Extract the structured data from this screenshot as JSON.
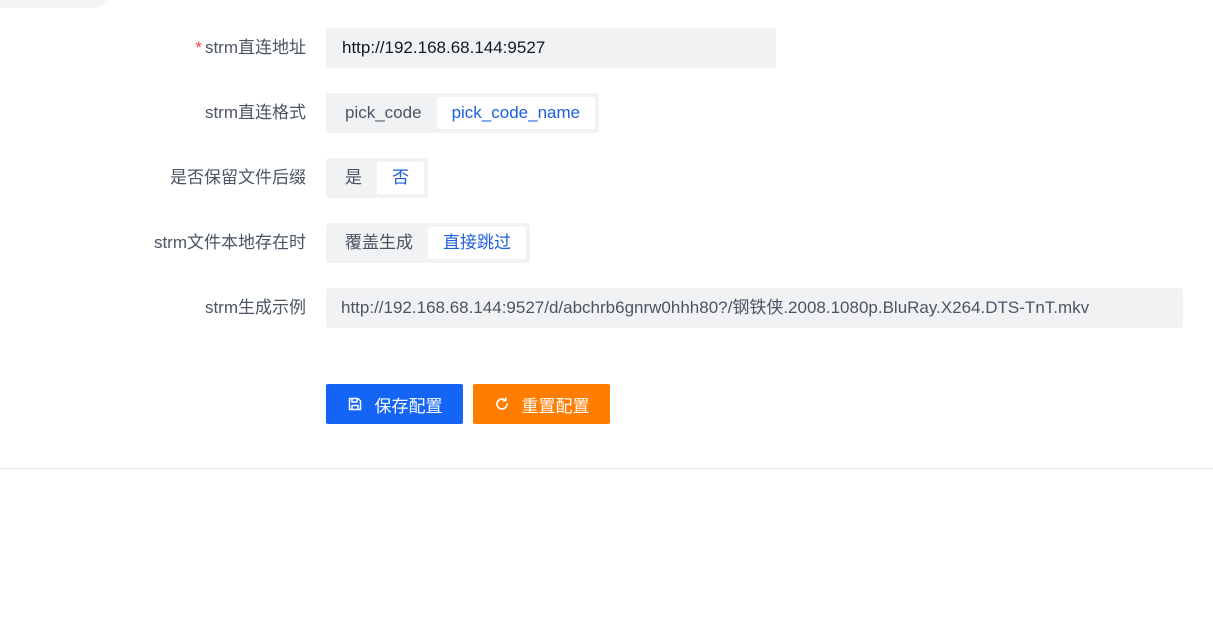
{
  "form": {
    "direct_url": {
      "label": "strm直连地址",
      "required_mark": "*",
      "value": "http://192.168.68.144:9527"
    },
    "direct_format": {
      "label": "strm直连格式",
      "options": [
        "pick_code",
        "pick_code_name"
      ],
      "selected": "pick_code_name"
    },
    "keep_suffix": {
      "label": "是否保留文件后缀",
      "options": [
        "是",
        "否"
      ],
      "selected": "否"
    },
    "local_exists": {
      "label": "strm文件本地存在时",
      "options": [
        "覆盖生成",
        "直接跳过"
      ],
      "selected": "直接跳过"
    },
    "example": {
      "label": "strm生成示例",
      "value": "http://192.168.68.144:9527/d/abchrb6gnrw0hhh80?/钢铁侠.2008.1080p.BluRay.X264.DTS-TnT.mkv"
    }
  },
  "actions": {
    "save_label": "保存配置",
    "save_icon": "save-icon",
    "reset_label": "重置配置",
    "reset_icon": "refresh-icon"
  },
  "colors": {
    "primary": "#1464f6",
    "warning": "#ff7d00",
    "required": "#ef4444",
    "active_text": "#1d5fe0"
  }
}
